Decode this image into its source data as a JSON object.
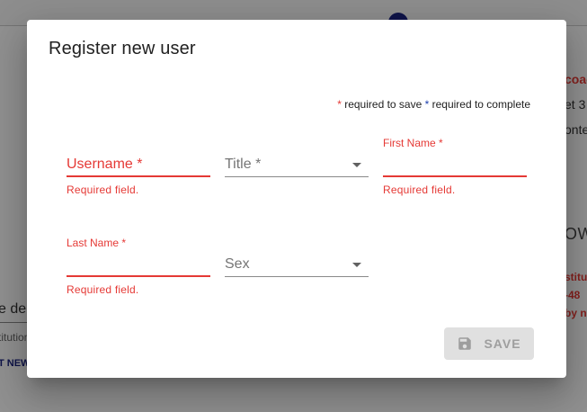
{
  "background": {
    "right_texts": [
      "coac",
      "et 3",
      "onte",
      "OW"
    ],
    "right_red_texts": [
      "stitu",
      "-48",
      "by na"
    ],
    "left_text": "e de",
    "left_small": "titution",
    "left_link": "T NEW"
  },
  "dialog": {
    "title": "Register new user",
    "legend": {
      "star_red": "*",
      "required_save": " required to save ",
      "star_blue": "*",
      "required_complete": " required to complete"
    },
    "fields": {
      "username": {
        "label": "Username *",
        "helper": "Required field.",
        "value": ""
      },
      "title": {
        "label": "Title *",
        "value": ""
      },
      "first_name": {
        "label": "First Name *",
        "helper": "Required field.",
        "value": ""
      },
      "last_name": {
        "label": "Last Name *",
        "helper": "Required field.",
        "value": ""
      },
      "sex": {
        "label": "Sex",
        "value": ""
      }
    },
    "save_button": {
      "label": "SAVE",
      "icon": "floppy-disk-icon",
      "disabled": true
    }
  },
  "colors": {
    "error": "#e53935",
    "required_complete_star": "#1e40af",
    "button_disabled_bg": "#e0e0e0",
    "button_disabled_text": "#9e9e9e"
  }
}
